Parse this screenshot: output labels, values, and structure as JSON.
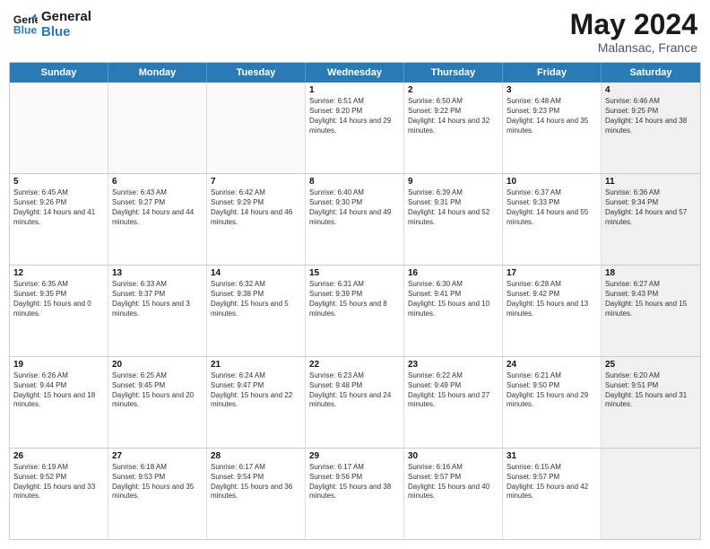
{
  "header": {
    "logo_line1": "General",
    "logo_line2": "Blue",
    "title": "May 2024",
    "subtitle": "Malansac, France"
  },
  "calendar": {
    "days": [
      "Sunday",
      "Monday",
      "Tuesday",
      "Wednesday",
      "Thursday",
      "Friday",
      "Saturday"
    ],
    "rows": [
      [
        {
          "day": "",
          "empty": true
        },
        {
          "day": "",
          "empty": true
        },
        {
          "day": "",
          "empty": true
        },
        {
          "day": "1",
          "sunrise": "6:51 AM",
          "sunset": "9:20 PM",
          "daylight": "14 hours and 29 minutes."
        },
        {
          "day": "2",
          "sunrise": "6:50 AM",
          "sunset": "9:22 PM",
          "daylight": "14 hours and 32 minutes."
        },
        {
          "day": "3",
          "sunrise": "6:48 AM",
          "sunset": "9:23 PM",
          "daylight": "14 hours and 35 minutes."
        },
        {
          "day": "4",
          "sunrise": "6:46 AM",
          "sunset": "9:25 PM",
          "daylight": "14 hours and 38 minutes.",
          "shaded": true
        }
      ],
      [
        {
          "day": "5",
          "sunrise": "6:45 AM",
          "sunset": "9:26 PM",
          "daylight": "14 hours and 41 minutes."
        },
        {
          "day": "6",
          "sunrise": "6:43 AM",
          "sunset": "9:27 PM",
          "daylight": "14 hours and 44 minutes."
        },
        {
          "day": "7",
          "sunrise": "6:42 AM",
          "sunset": "9:29 PM",
          "daylight": "14 hours and 46 minutes."
        },
        {
          "day": "8",
          "sunrise": "6:40 AM",
          "sunset": "9:30 PM",
          "daylight": "14 hours and 49 minutes."
        },
        {
          "day": "9",
          "sunrise": "6:39 AM",
          "sunset": "9:31 PM",
          "daylight": "14 hours and 52 minutes."
        },
        {
          "day": "10",
          "sunrise": "6:37 AM",
          "sunset": "9:33 PM",
          "daylight": "14 hours and 55 minutes."
        },
        {
          "day": "11",
          "sunrise": "6:36 AM",
          "sunset": "9:34 PM",
          "daylight": "14 hours and 57 minutes.",
          "shaded": true
        }
      ],
      [
        {
          "day": "12",
          "sunrise": "6:35 AM",
          "sunset": "9:35 PM",
          "daylight": "15 hours and 0 minutes."
        },
        {
          "day": "13",
          "sunrise": "6:33 AM",
          "sunset": "9:37 PM",
          "daylight": "15 hours and 3 minutes."
        },
        {
          "day": "14",
          "sunrise": "6:32 AM",
          "sunset": "9:38 PM",
          "daylight": "15 hours and 5 minutes."
        },
        {
          "day": "15",
          "sunrise": "6:31 AM",
          "sunset": "9:39 PM",
          "daylight": "15 hours and 8 minutes."
        },
        {
          "day": "16",
          "sunrise": "6:30 AM",
          "sunset": "9:41 PM",
          "daylight": "15 hours and 10 minutes."
        },
        {
          "day": "17",
          "sunrise": "6:28 AM",
          "sunset": "9:42 PM",
          "daylight": "15 hours and 13 minutes."
        },
        {
          "day": "18",
          "sunrise": "6:27 AM",
          "sunset": "9:43 PM",
          "daylight": "15 hours and 15 minutes.",
          "shaded": true
        }
      ],
      [
        {
          "day": "19",
          "sunrise": "6:26 AM",
          "sunset": "9:44 PM",
          "daylight": "15 hours and 18 minutes."
        },
        {
          "day": "20",
          "sunrise": "6:25 AM",
          "sunset": "9:45 PM",
          "daylight": "15 hours and 20 minutes."
        },
        {
          "day": "21",
          "sunrise": "6:24 AM",
          "sunset": "9:47 PM",
          "daylight": "15 hours and 22 minutes."
        },
        {
          "day": "22",
          "sunrise": "6:23 AM",
          "sunset": "9:48 PM",
          "daylight": "15 hours and 24 minutes."
        },
        {
          "day": "23",
          "sunrise": "6:22 AM",
          "sunset": "9:49 PM",
          "daylight": "15 hours and 27 minutes."
        },
        {
          "day": "24",
          "sunrise": "6:21 AM",
          "sunset": "9:50 PM",
          "daylight": "15 hours and 29 minutes."
        },
        {
          "day": "25",
          "sunrise": "6:20 AM",
          "sunset": "9:51 PM",
          "daylight": "15 hours and 31 minutes.",
          "shaded": true
        }
      ],
      [
        {
          "day": "26",
          "sunrise": "6:19 AM",
          "sunset": "9:52 PM",
          "daylight": "15 hours and 33 minutes."
        },
        {
          "day": "27",
          "sunrise": "6:18 AM",
          "sunset": "9:53 PM",
          "daylight": "15 hours and 35 minutes."
        },
        {
          "day": "28",
          "sunrise": "6:17 AM",
          "sunset": "9:54 PM",
          "daylight": "15 hours and 36 minutes."
        },
        {
          "day": "29",
          "sunrise": "6:17 AM",
          "sunset": "9:56 PM",
          "daylight": "15 hours and 38 minutes."
        },
        {
          "day": "30",
          "sunrise": "6:16 AM",
          "sunset": "9:57 PM",
          "daylight": "15 hours and 40 minutes."
        },
        {
          "day": "31",
          "sunrise": "6:15 AM",
          "sunset": "9:57 PM",
          "daylight": "15 hours and 42 minutes."
        },
        {
          "day": "",
          "empty": true,
          "shaded": true
        }
      ]
    ]
  }
}
